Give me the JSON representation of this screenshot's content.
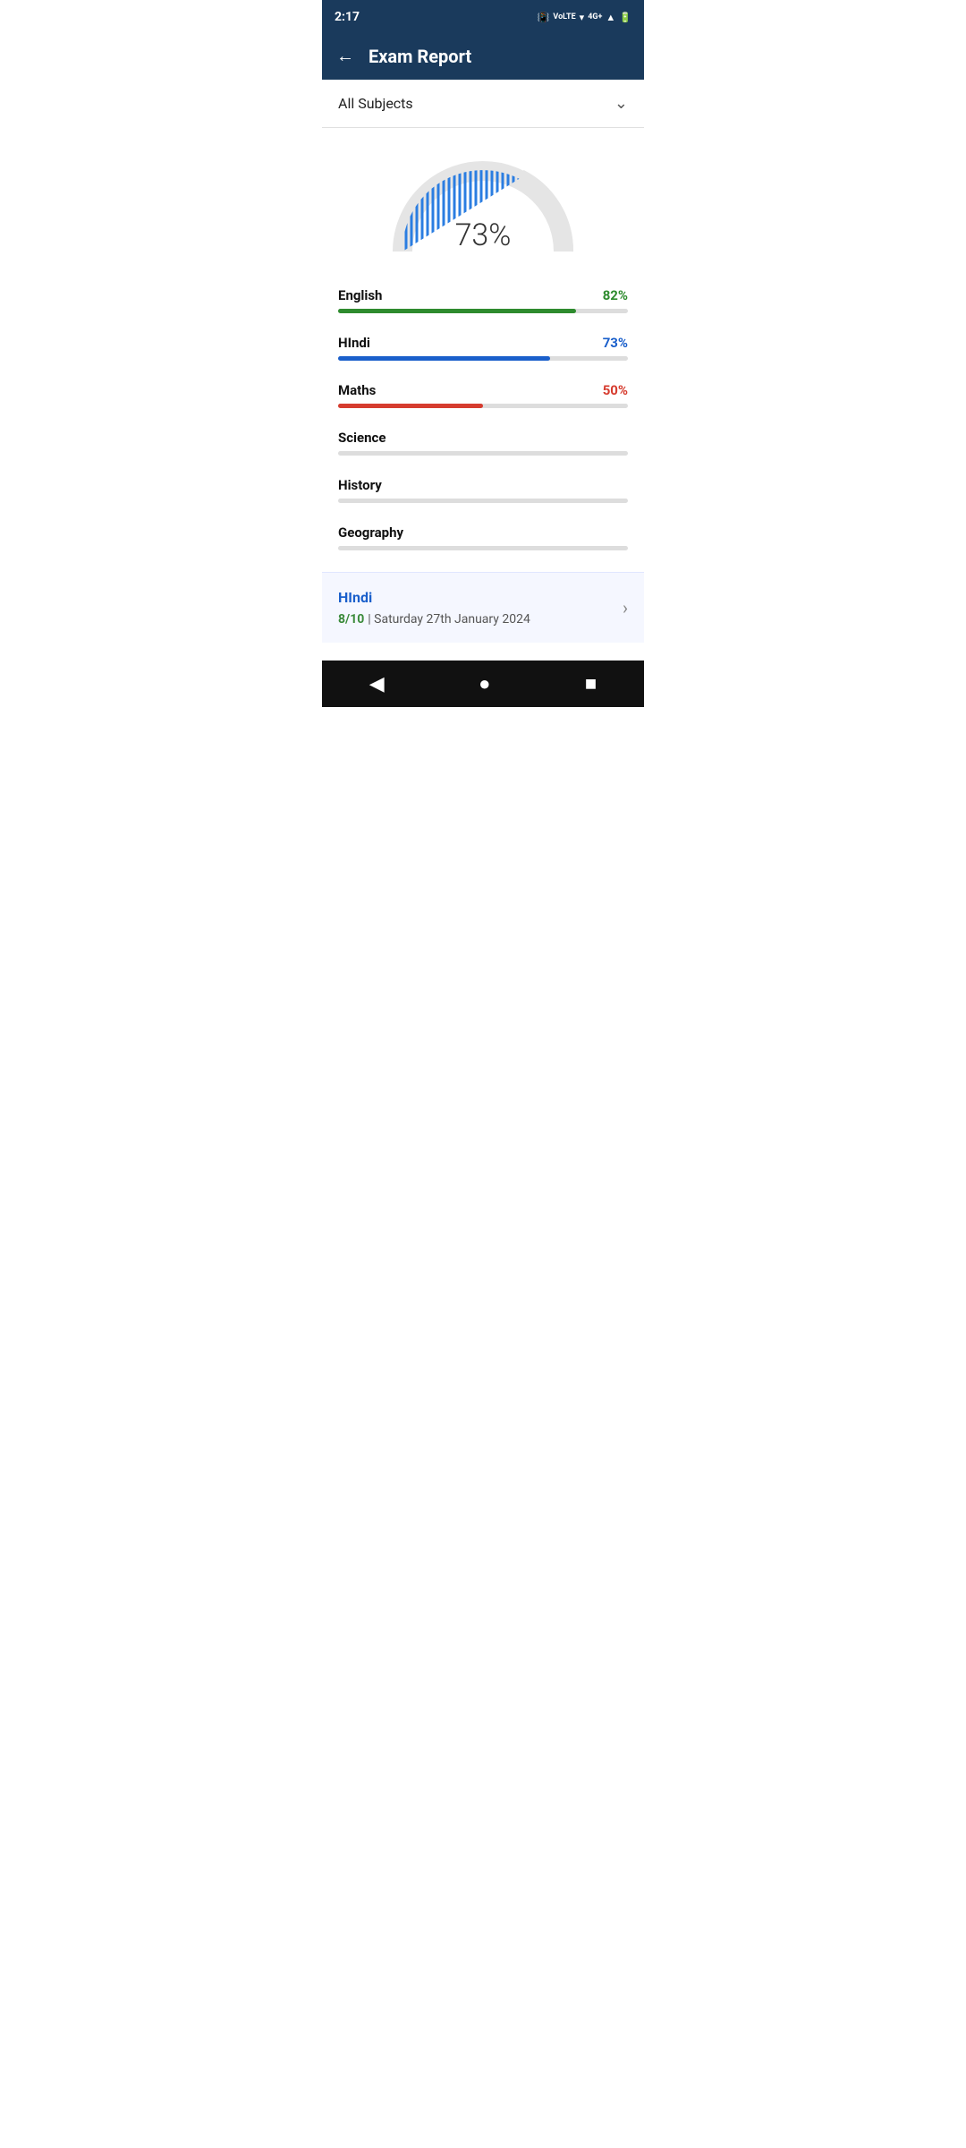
{
  "statusBar": {
    "time": "2:17",
    "icons": [
      "vibrate",
      "volte",
      "wifi",
      "4G+",
      "signal",
      "battery"
    ]
  },
  "header": {
    "backLabel": "←",
    "title": "Exam Report"
  },
  "subjectDropdown": {
    "label": "All Subjects",
    "icon": "⌄"
  },
  "gauge": {
    "percent": 73,
    "displayText": "73%",
    "filledColor": "#2a7de1",
    "emptyColor": "#e5e5e5"
  },
  "subjects": [
    {
      "name": "English",
      "percent": 82,
      "displayPercent": "82%",
      "color": "#2e8b2e",
      "hasData": true
    },
    {
      "name": "HIndi",
      "percent": 73,
      "displayPercent": "73%",
      "color": "#1a5fcb",
      "hasData": true
    },
    {
      "name": "Maths",
      "percent": 50,
      "displayPercent": "50%",
      "color": "#d63c2f",
      "hasData": true
    },
    {
      "name": "Science",
      "percent": 0,
      "displayPercent": "",
      "color": "#ccc",
      "hasData": false
    },
    {
      "name": "History",
      "percent": 0,
      "displayPercent": "",
      "color": "#ccc",
      "hasData": false
    },
    {
      "name": "Geography",
      "percent": 0,
      "displayPercent": "",
      "color": "#ccc",
      "hasData": false
    }
  ],
  "recentExam": {
    "subject": "HIndi",
    "score": "8/10",
    "separator": " | ",
    "date": "Saturday 27th January 2024",
    "chevron": "›"
  },
  "navBar": {
    "back": "◀",
    "home": "●",
    "square": "■"
  }
}
